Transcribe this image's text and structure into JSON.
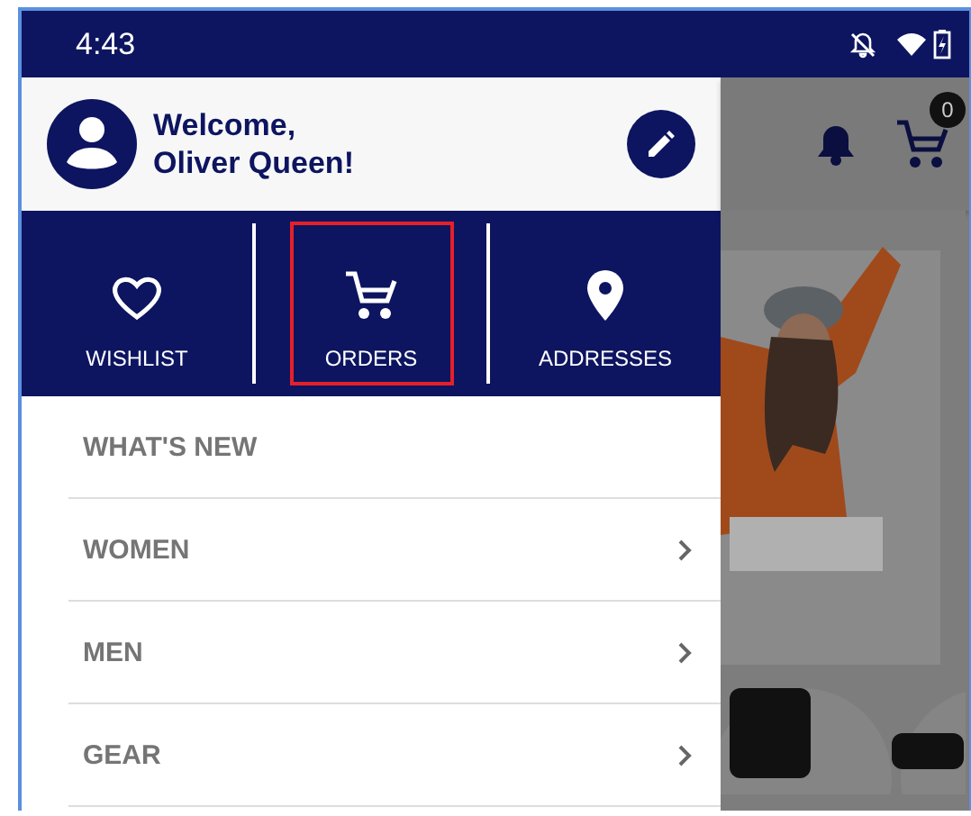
{
  "status_bar": {
    "time": "4:43"
  },
  "drawer": {
    "greeting": "Welcome,",
    "user_name": "Oliver Queen!",
    "shortcuts": [
      {
        "label": "WISHLIST",
        "kind": "wishlist",
        "highlighted": false
      },
      {
        "label": "ORDERS",
        "kind": "orders",
        "highlighted": true
      },
      {
        "label": "ADDRESSES",
        "kind": "addresses",
        "highlighted": false
      }
    ],
    "menu": [
      {
        "label": "WHAT'S NEW",
        "has_submenu": false
      },
      {
        "label": "WOMEN",
        "has_submenu": true
      },
      {
        "label": "MEN",
        "has_submenu": true
      },
      {
        "label": "GEAR",
        "has_submenu": true
      }
    ]
  },
  "app_bar": {
    "cart_count": "0"
  }
}
